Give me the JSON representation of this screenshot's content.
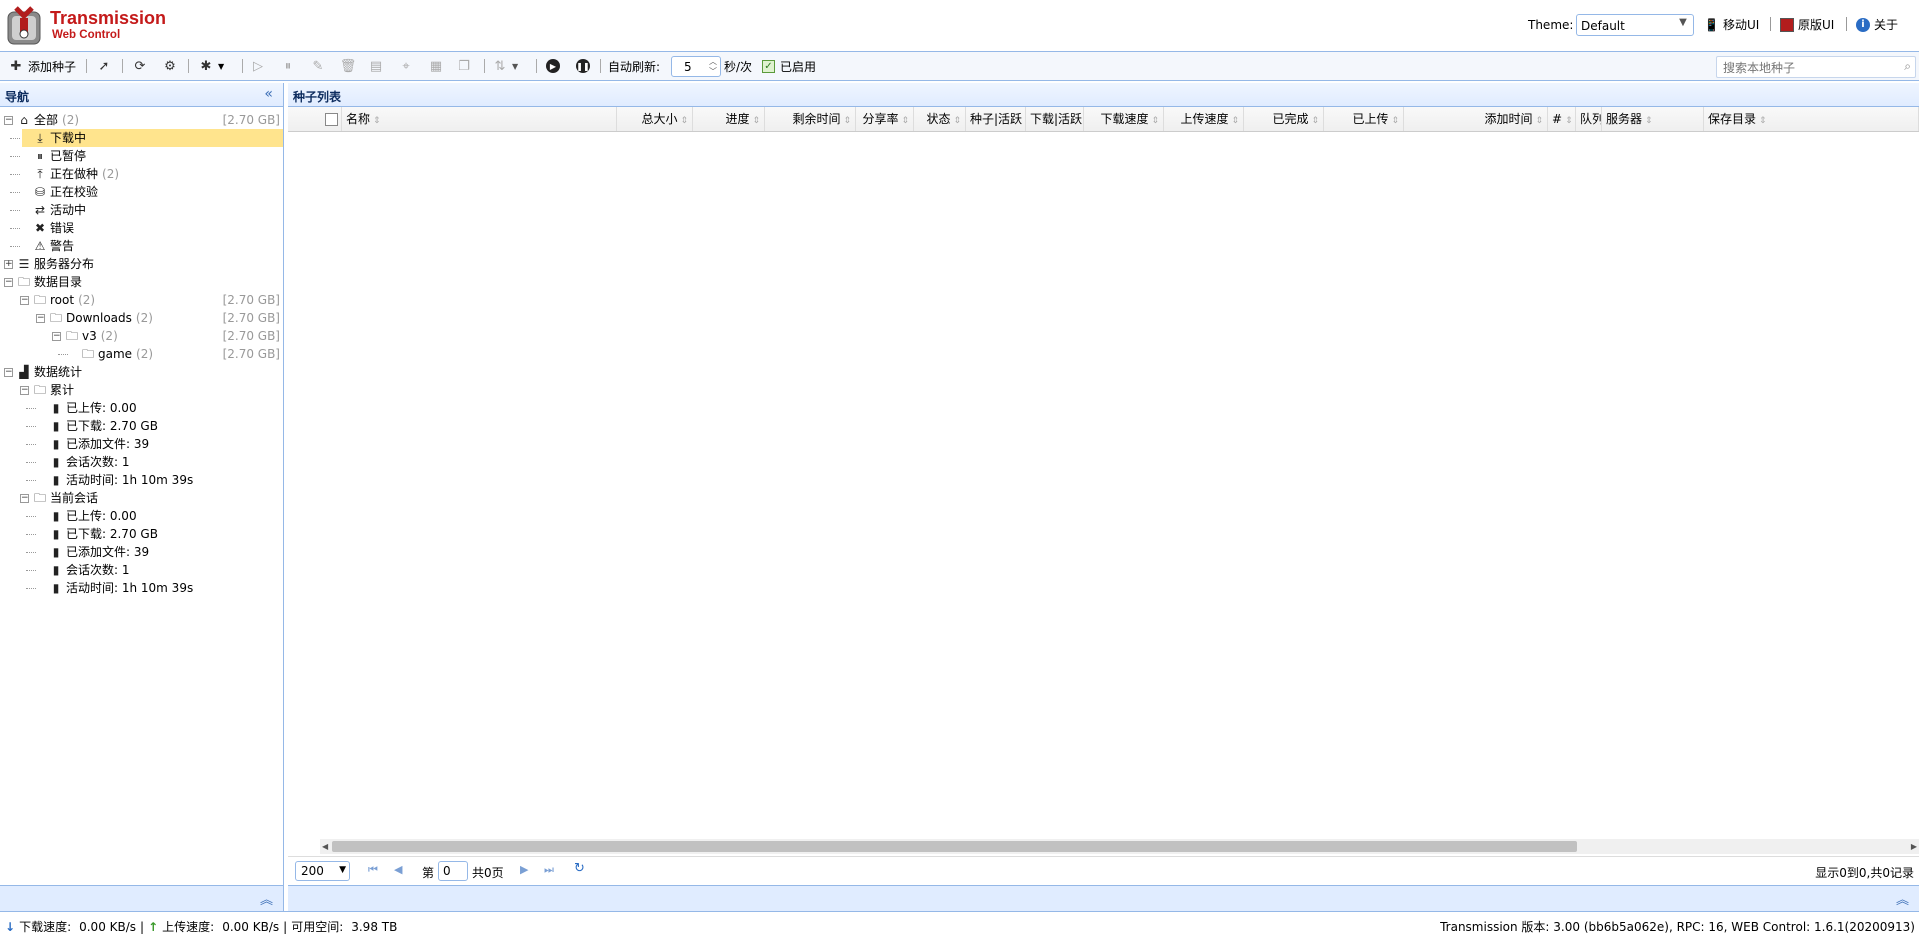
{
  "app": {
    "title": "Transmission",
    "subtitle": "Web Control"
  },
  "header": {
    "theme_label": "Theme:",
    "theme_value": "Default",
    "links": [
      {
        "label": "移动UI",
        "icon": "mobile-icon"
      },
      {
        "label": "原版UI",
        "icon": "original-ui-icon"
      },
      {
        "label": "关于",
        "icon": "info-icon"
      }
    ]
  },
  "toolbar": {
    "add_label": "添加种子",
    "auto_refresh_label": "自动刷新:",
    "refresh_value": "5",
    "refresh_unit": "秒/次",
    "enabled_label": "已启用",
    "search_placeholder": "搜索本地种子"
  },
  "nav": {
    "title": "导航",
    "items": [
      {
        "label": "全部",
        "count": "(2)",
        "size": "[2.70 GB]",
        "icon": "home-icon"
      },
      {
        "label": "下载中",
        "icon": "download-icon"
      },
      {
        "label": "已暂停",
        "icon": "pause-icon"
      },
      {
        "label": "正在做种",
        "count": "(2)",
        "icon": "upload-icon"
      },
      {
        "label": "正在校验",
        "icon": "check-icon"
      },
      {
        "label": "活动中",
        "icon": "link-icon"
      },
      {
        "label": "错误",
        "icon": "error-icon"
      },
      {
        "label": "警告",
        "icon": "warning-icon"
      },
      {
        "label": "服务器分布",
        "icon": "server-icon"
      },
      {
        "label": "数据目录",
        "icon": "folder-icon"
      },
      {
        "label": "root",
        "count": "(2)",
        "size": "[2.70 GB]",
        "icon": "folder-icon"
      },
      {
        "label": "Downloads",
        "count": "(2)",
        "size": "[2.70 GB]",
        "icon": "folder-icon"
      },
      {
        "label": "v3",
        "count": "(2)",
        "size": "[2.70 GB]",
        "icon": "folder-icon"
      },
      {
        "label": "game",
        "count": "(2)",
        "size": "[2.70 GB]",
        "icon": "folder-icon"
      },
      {
        "label": "数据统计",
        "icon": "stats-icon"
      },
      {
        "label": "累计",
        "icon": "folder-icon"
      },
      {
        "label": "已上传:  0.00",
        "icon": "file-icon"
      },
      {
        "label": "已下载:  2.70 GB",
        "icon": "file-icon"
      },
      {
        "label": "已添加文件:  39",
        "icon": "file-icon"
      },
      {
        "label": "会话次数:  1",
        "icon": "file-icon"
      },
      {
        "label": "活动时间:  1h 10m 39s",
        "icon": "file-icon"
      },
      {
        "label": "当前会话",
        "icon": "folder-icon"
      },
      {
        "label": "已上传:  0.00",
        "icon": "file-icon"
      },
      {
        "label": "已下载:  2.70 GB",
        "icon": "file-icon"
      },
      {
        "label": "已添加文件:  39",
        "icon": "file-icon"
      },
      {
        "label": "会话次数:  1",
        "icon": "file-icon"
      },
      {
        "label": "活动时间:  1h 10m 39s",
        "icon": "file-icon"
      }
    ]
  },
  "list": {
    "title": "种子列表",
    "columns": [
      "名称",
      "总大小",
      "进度",
      "剩余时间",
      "分享率",
      "状态",
      "种子|活跃",
      "下载|活跃",
      "下载速度",
      "上传速度",
      "已完成",
      "已上传",
      "添加时间",
      "#",
      "队列",
      "服务器",
      "保存目录"
    ]
  },
  "pager": {
    "page_size": "200",
    "page_prefix": "第",
    "page_value": "0",
    "page_total": "共0页",
    "summary": "显示0到0,共0记录"
  },
  "statusbar": {
    "download_label": "下载速度:",
    "download_value": "0.00 KB/s",
    "upload_label": "上传速度:",
    "upload_value": "0.00 KB/s",
    "free_label": "可用空间:",
    "free_value": "3.98 TB",
    "version": "Transmission 版本: 3.00 (bb6b5a062e), RPC: 16, WEB Control: 1.6.1(20200913)"
  },
  "colors": {
    "accent": "#95b8e7",
    "brand": "#c41a1a",
    "selected": "#ffe48d",
    "panel": "#e0ecff"
  }
}
